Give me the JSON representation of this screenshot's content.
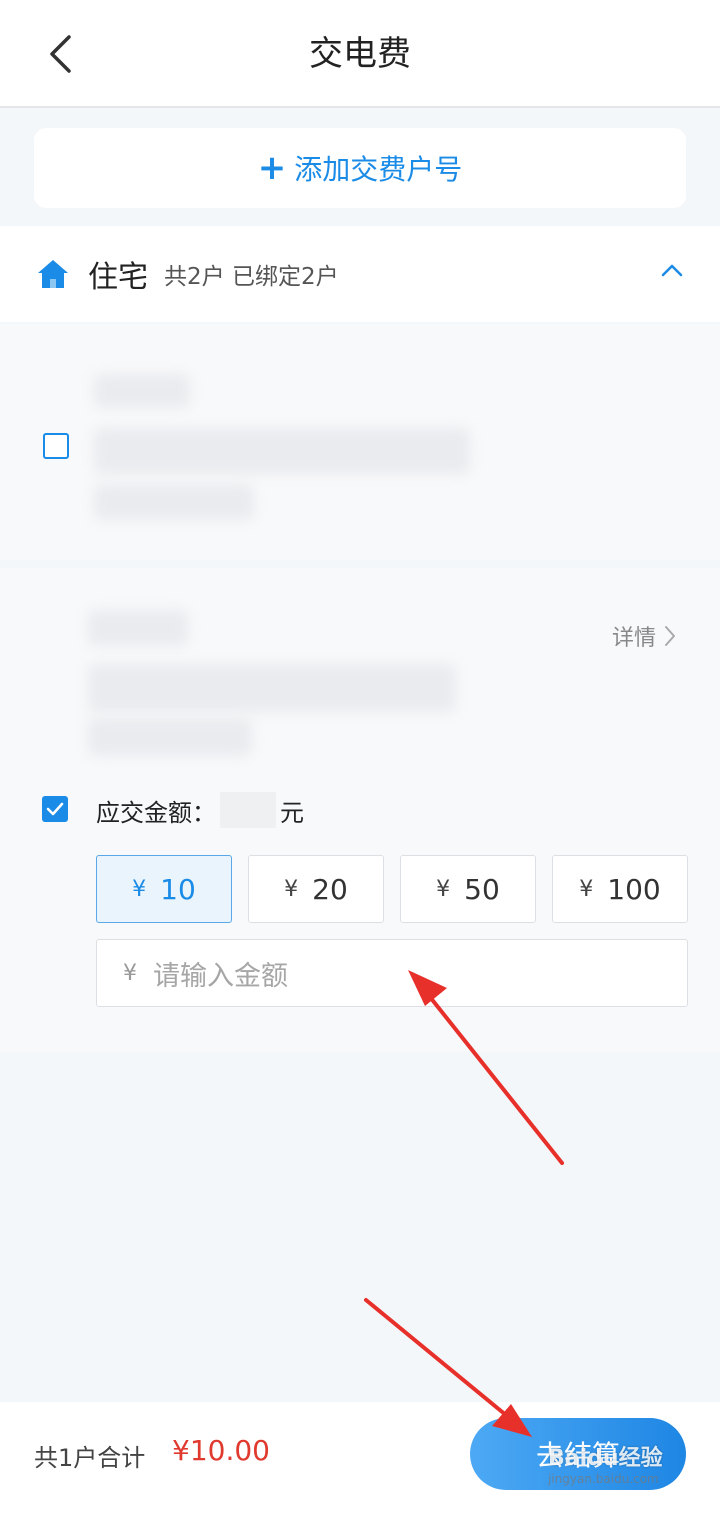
{
  "header": {
    "title": "交电费"
  },
  "add_account": {
    "icon": "plus-icon",
    "label": "添加交费户号"
  },
  "section": {
    "icon": "home-icon",
    "name": "住宅",
    "count": "共2户 已绑定2户"
  },
  "account2": {
    "details_label": "详情",
    "amount_label": "应交金额：",
    "amount_unit": "元",
    "chips": [
      {
        "yen": "¥",
        "value": "10"
      },
      {
        "yen": "¥",
        "value": "20"
      },
      {
        "yen": "¥",
        "value": "50"
      },
      {
        "yen": "¥",
        "value": "100"
      }
    ],
    "input_yen": "¥",
    "input_placeholder": "请输入金额"
  },
  "footer": {
    "total_label": "共1户合计",
    "total_value": "¥10.00",
    "checkout_label": "去结算"
  },
  "watermark": {
    "text": "Baidu经验",
    "sub": "jingyan.baidu.com"
  },
  "colors": {
    "accent": "#1a8be6",
    "price": "#e03a2f",
    "annotation_arrow": "#e8302a"
  }
}
